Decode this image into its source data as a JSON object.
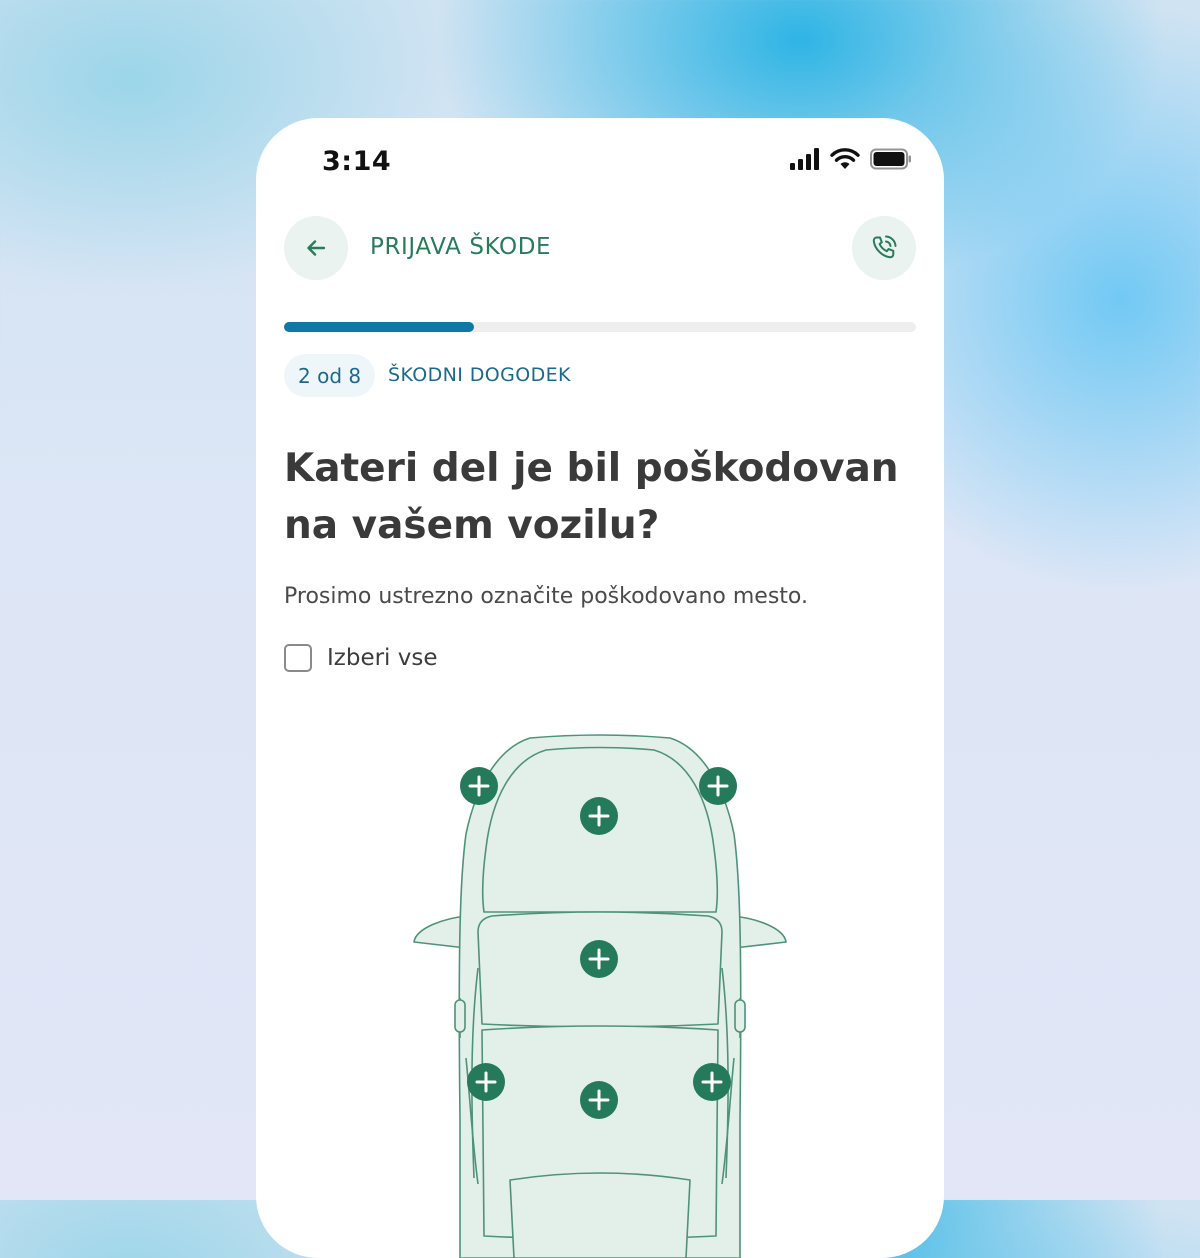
{
  "status_bar": {
    "time": "3:14",
    "icons": [
      "signal-icon",
      "wifi-icon",
      "battery-icon"
    ]
  },
  "header": {
    "title": "PRIJAVA ŠKODE",
    "back_icon": "arrow-left-icon",
    "call_icon": "phone-call-icon"
  },
  "progress": {
    "current": 2,
    "total": 8,
    "fraction": 0.3
  },
  "step": {
    "counter": "2 od 8",
    "label": "ŠKODNI DOGODEK"
  },
  "question": "Kateri del je bil poškodovan na vašem vozilu?",
  "instruction": "Prosimo ustrezno označite poškodovano mesto.",
  "select_all": {
    "label": "Izberi vse",
    "checked": false
  },
  "car_diagram": {
    "markers_icon": "plus-icon",
    "markers": [
      "front-left",
      "hood",
      "front-right",
      "windshield",
      "rear-left",
      "roof",
      "rear-right"
    ]
  },
  "colors": {
    "brand_green": "#2a7a5d",
    "marker_green": "#257a5c",
    "progress_blue": "#0f78a5",
    "car_fill": "#e3f0ea",
    "car_stroke": "#4f927a"
  }
}
